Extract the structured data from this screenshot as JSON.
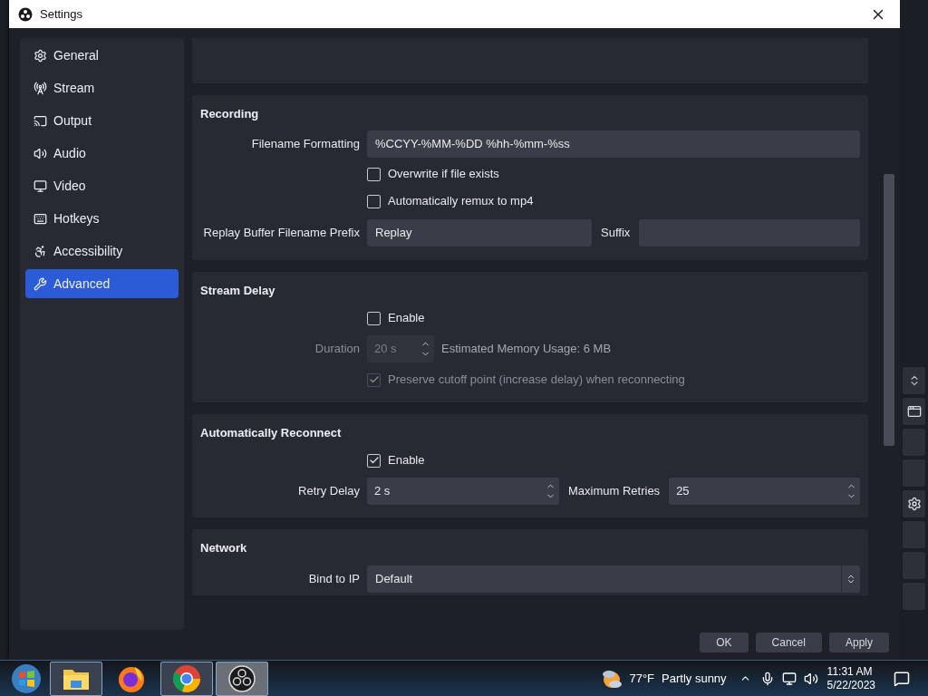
{
  "window": {
    "title": "Settings"
  },
  "sidebar": {
    "items": [
      {
        "label": "General",
        "selected": false
      },
      {
        "label": "Stream",
        "selected": false
      },
      {
        "label": "Output",
        "selected": false
      },
      {
        "label": "Audio",
        "selected": false
      },
      {
        "label": "Video",
        "selected": false
      },
      {
        "label": "Hotkeys",
        "selected": false
      },
      {
        "label": "Accessibility",
        "selected": false
      },
      {
        "label": "Advanced",
        "selected": true
      }
    ]
  },
  "sections": [
    {
      "kind": "blank"
    },
    {
      "kind": "group",
      "title": "Recording",
      "rows": [
        {
          "kind": "text",
          "label": "Filename Formatting",
          "value": "%CCYY-%MM-%DD %hh-%mm-%ss"
        },
        {
          "kind": "checkbox",
          "label": "Overwrite if file exists",
          "checked": false,
          "disabled": false
        },
        {
          "kind": "checkbox",
          "label": "Automatically remux to mp4",
          "checked": false,
          "disabled": false
        },
        {
          "kind": "text_pair",
          "label": "Replay Buffer Filename Prefix",
          "value": "Replay",
          "label_2": "Suffix"
        }
      ]
    },
    {
      "kind": "group",
      "title": "Stream Delay",
      "rows": [
        {
          "kind": "checkbox",
          "label": "Enable",
          "checked": false,
          "disabled": false
        },
        {
          "kind": "spin",
          "label": "Duration",
          "value": "20 s",
          "note": "Estimated Memory Usage: 6 MB",
          "disabled": true
        },
        {
          "kind": "checkbox",
          "label": "Preserve cutoff point (increase delay) when reconnecting",
          "checked": true,
          "disabled": true
        }
      ]
    },
    {
      "kind": "group",
      "title": "Automatically Reconnect",
      "rows": [
        {
          "kind": "checkbox",
          "label": "Enable",
          "checked": true,
          "disabled": false
        },
        {
          "kind": "spin_pair",
          "label": "Retry Delay",
          "value": "2 s",
          "label_2": "Maximum Retries",
          "value_2": "25"
        }
      ]
    },
    {
      "kind": "group",
      "title": "Network",
      "rows": [
        {
          "kind": "select",
          "label": "Bind to IP",
          "value": "Default"
        }
      ]
    }
  ],
  "buttons": [
    {
      "label": "OK"
    },
    {
      "label": "Cancel"
    },
    {
      "label": "Apply"
    }
  ],
  "taskbar": {
    "apps": [
      {
        "kind": "start",
        "running": false,
        "selected": false
      },
      {
        "kind": "folder",
        "running": true,
        "selected": false
      },
      {
        "kind": "firefox",
        "running": false,
        "selected": false
      },
      {
        "kind": "chrome",
        "running": true,
        "selected": false
      },
      {
        "kind": "obs",
        "running": true,
        "selected": true
      }
    ],
    "weather": {
      "temperature": "77°F",
      "condition": "Partly sunny"
    },
    "clock": {
      "time": "11:31 AM",
      "date": "5/22/2023"
    }
  }
}
